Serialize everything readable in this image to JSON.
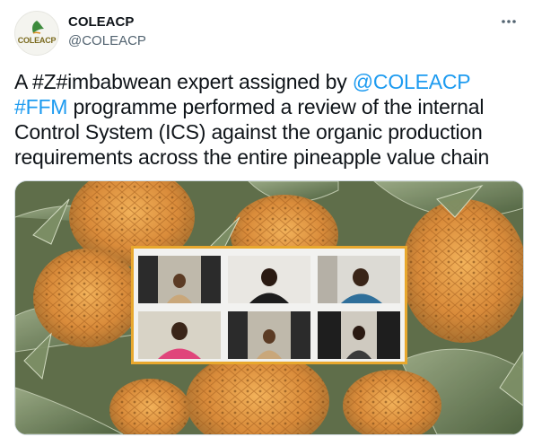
{
  "author": {
    "display_name": "COLEACP",
    "handle": "@COLEACP",
    "avatar_text": "COLEACP"
  },
  "tweet": {
    "text_parts": [
      {
        "text": "A #Z#imbabwean expert assigned by ",
        "link": false
      },
      {
        "text": "@COLEACP",
        "link": true
      },
      {
        "text": " ",
        "link": false
      },
      {
        "text": "#FFM",
        "link": true
      },
      {
        "text": " programme performed a review of the internal Control System (ICS) against the organic production requirements across the entire pineapple value chain",
        "link": false
      }
    ]
  },
  "media": {
    "description": "video-call-collage-over-pineapples",
    "participants": 6
  },
  "colors": {
    "link": "#1d9bf0",
    "text": "#0f1419",
    "secondary": "#536471",
    "frame": "#e8a82e"
  },
  "icons": {
    "more": "more-dots-icon",
    "avatar_logo": "coleacp-logo-icon"
  }
}
